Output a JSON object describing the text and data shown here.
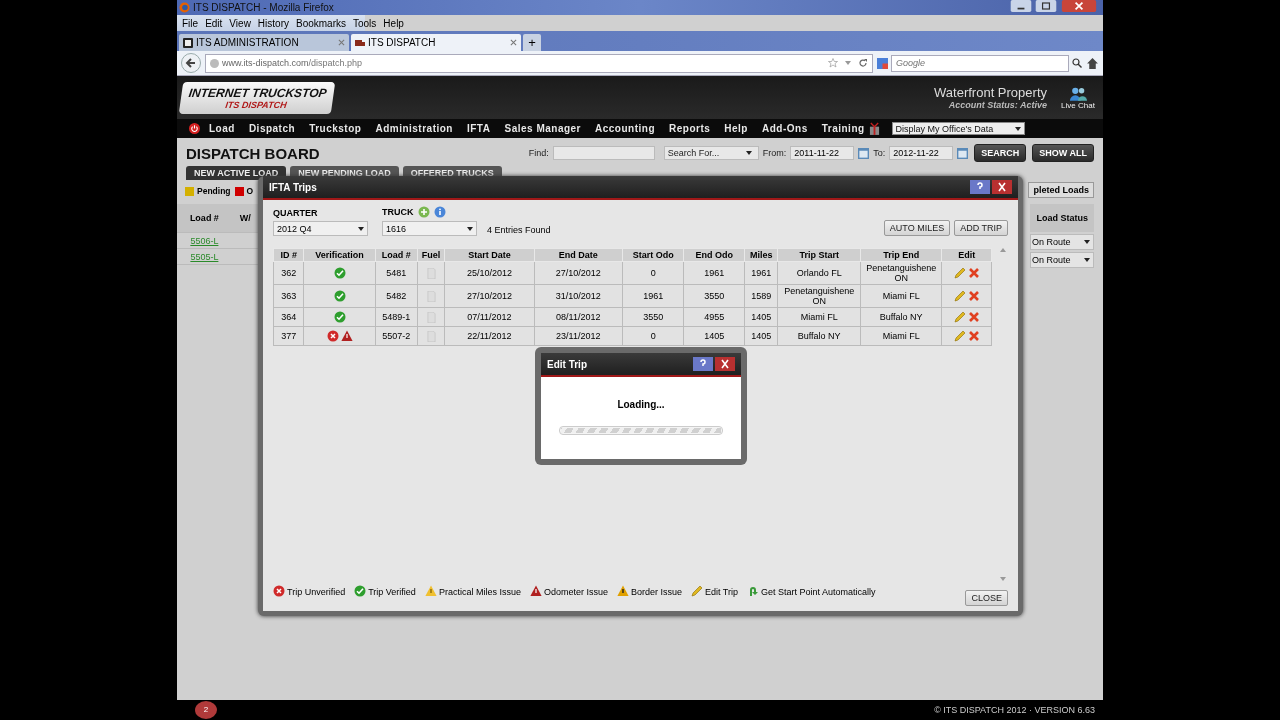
{
  "browser": {
    "title": "ITS DISPATCH - Mozilla Firefox",
    "menu": [
      "File",
      "Edit",
      "View",
      "History",
      "Bookmarks",
      "Tools",
      "Help"
    ],
    "tabs": [
      {
        "label": "ITS ADMINISTRATION",
        "selected": false
      },
      {
        "label": "ITS DISPATCH",
        "selected": true
      }
    ],
    "new_tab": "+",
    "url_host": "www.its-dispatch.com",
    "url_path": "/dispatch.php",
    "search": {
      "placeholder": "Google"
    }
  },
  "header": {
    "logo_top": "INTERNET TRUCKSTOP",
    "logo_bottom": "ITS DISPATCH",
    "account": "Waterfront Property",
    "status": "Account Status: Active",
    "chat": "Live Chat"
  },
  "nav": {
    "items": [
      "Load",
      "Dispatch",
      "Truckstop",
      "Administration",
      "IFTA",
      "Sales Manager",
      "Accounting",
      "Reports",
      "Help",
      "Add-Ons",
      "Training"
    ],
    "office_select": "Display My Office's Data"
  },
  "board": {
    "title": "DISPATCH BOARD",
    "find_label": "Find:",
    "search_for": "Search For...",
    "from_label": "From:",
    "from": "2011-11-22",
    "to_label": "To:",
    "to": "2012-11-22",
    "search_button": "SEARCH",
    "show_all_button": "SHOW ALL",
    "tabs": [
      {
        "label": "NEW ACTIVE LOAD",
        "selected": true
      },
      {
        "label": "NEW PENDING LOAD",
        "selected": false
      },
      {
        "label": "OFFERED TRUCKS",
        "selected": false
      }
    ],
    "legend": [
      {
        "label": "Pending",
        "color": "#d4b000"
      },
      {
        "label": "O",
        "color": "#d00000"
      }
    ],
    "columns": [
      "Load #",
      "W/"
    ],
    "loads": [
      "5506-L",
      "5505-L"
    ],
    "right_tab": "pleted Loads",
    "status_column": "Load Status",
    "statuses": [
      "On Route",
      "On Route"
    ]
  },
  "ifta": {
    "title": "IFTA Trips",
    "quarter_label": "QUARTER",
    "quarter": "2012 Q4",
    "truck_label": "TRUCK",
    "truck": "1616",
    "entries": "4 Entries Found",
    "auto_miles": "AUTO MILES",
    "add_trip": "ADD TRIP",
    "columns": [
      "ID #",
      "Verification",
      "Load #",
      "Fuel",
      "Start Date",
      "End Date",
      "Start Odo",
      "End Odo",
      "Miles",
      "Trip Start",
      "Trip End",
      "Edit"
    ],
    "rows": [
      {
        "id": "362",
        "verification": [
          {
            "kind": "verified"
          }
        ],
        "load": "5481",
        "start_date": "25/10/2012",
        "end_date": "27/10/2012",
        "start_odo": "0",
        "end_odo": "1961",
        "miles": "1961",
        "trip_start": "Orlando FL",
        "trip_end": "Penetanguishene ON"
      },
      {
        "id": "363",
        "verification": [
          {
            "kind": "verified"
          }
        ],
        "load": "5482",
        "start_date": "27/10/2012",
        "end_date": "31/10/2012",
        "start_odo": "1961",
        "end_odo": "3550",
        "miles": "1589",
        "trip_start": "Penetanguishene ON",
        "trip_end": "Miami FL"
      },
      {
        "id": "364",
        "verification": [
          {
            "kind": "verified"
          }
        ],
        "load": "5489-1",
        "start_date": "07/11/2012",
        "end_date": "08/11/2012",
        "start_odo": "3550",
        "end_odo": "4955",
        "miles": "1405",
        "trip_start": "Miami FL",
        "trip_end": "Buffalo NY"
      },
      {
        "id": "377",
        "verification": [
          {
            "kind": "unverified"
          },
          {
            "kind": "odometer"
          }
        ],
        "load": "5507-2",
        "start_date": "22/11/2012",
        "end_date": "23/11/2012",
        "start_odo": "0",
        "end_odo": "1405",
        "miles": "1405",
        "trip_start": "Buffalo NY",
        "trip_end": "Miami FL"
      }
    ],
    "legend": [
      {
        "kind": "unverified",
        "label": "Trip Unverified"
      },
      {
        "kind": "verified",
        "label": "Trip Verified"
      },
      {
        "kind": "practical",
        "label": "Practical Miles Issue"
      },
      {
        "kind": "odometer",
        "label": "Odometer Issue"
      },
      {
        "kind": "border",
        "label": "Border Issue"
      },
      {
        "kind": "edit",
        "label": "Edit Trip"
      },
      {
        "kind": "startpoint",
        "label": "Get Start Point Automatically"
      }
    ],
    "close": "CLOSE"
  },
  "edit_trip": {
    "title": "Edit Trip",
    "message": "Loading...",
    "level": 1
  },
  "footer": {
    "badge": "2",
    "copyright": "© ITS DISPATCH 2012 · VERSION 6.63"
  }
}
